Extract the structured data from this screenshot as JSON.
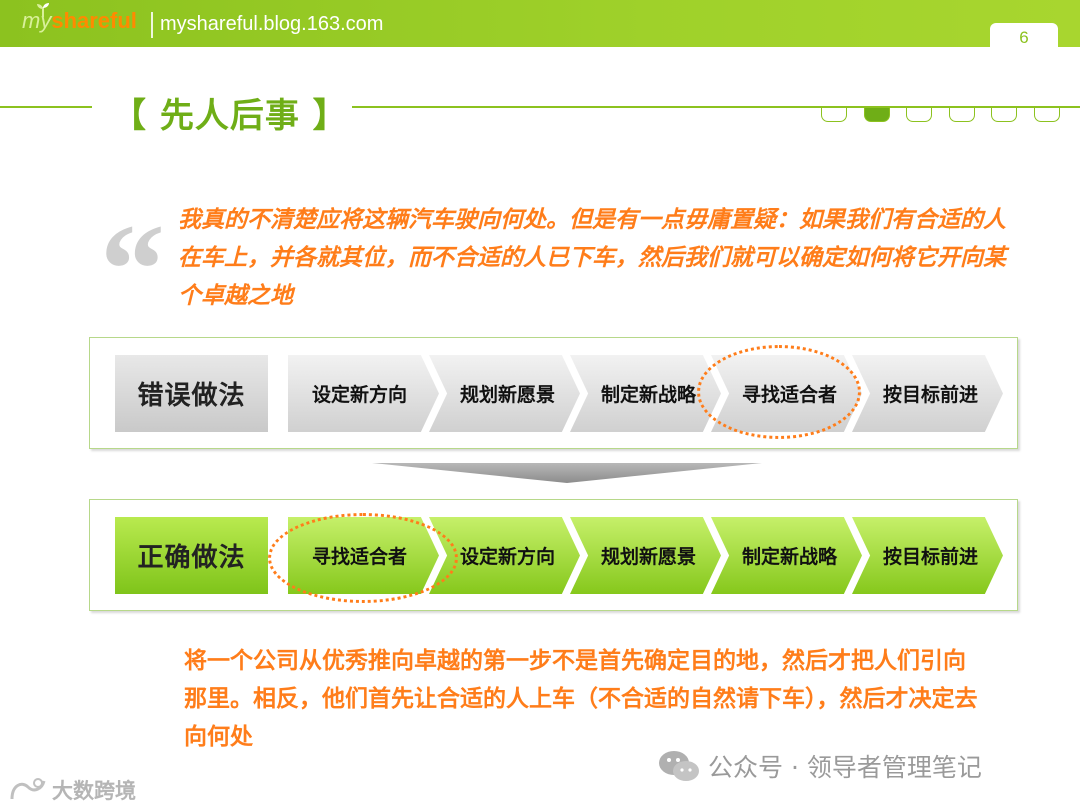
{
  "header": {
    "logo_my": "my",
    "logo_share": "shareful",
    "url": "myshareful.blog.163.com",
    "page_number": "6"
  },
  "title": "【 先人后事 】",
  "nav_markers": {
    "count": 6,
    "active_index": 1
  },
  "quote": {
    "mark": "“",
    "text": "我真的不清楚应将这辆汽车驶向何处。但是有一点毋庸置疑：如果我们有合适的人在车上，并各就其位，而不合适的人已下车，然后我们就可以确定如何将它开向某个卓越之地"
  },
  "wrong_way": {
    "label": "错误做法",
    "steps": [
      "设定新方向",
      "规划新愿景",
      "制定新战略",
      "寻找适合者",
      "按目标前进"
    ],
    "highlighted_step": "寻找适合者"
  },
  "right_way": {
    "label": "正确做法",
    "steps": [
      "寻找适合者",
      "设定新方向",
      "规划新愿景",
      "制定新战略",
      "按目标前进"
    ],
    "highlighted_step": "寻找适合者"
  },
  "conclusion": "将一个公司从优秀推向卓越的第一步不是首先确定目的地，然后才把人们引向那里。相反，他们首先让合适的人上车（不合适的自然请下车），然后才决定去向何处",
  "watermarks": {
    "right": "公众号 · 领导者管理笔记",
    "left": "大数跨境"
  },
  "colors": {
    "brand_green": "#8cc21f",
    "accent_orange": "#ff7d1a",
    "gray_step": "#d0d0d0",
    "green_step": "#86c81c"
  }
}
